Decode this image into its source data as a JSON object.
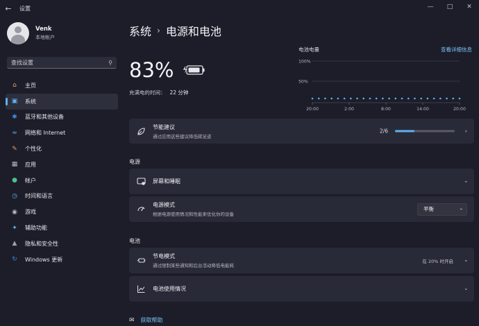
{
  "window": {
    "title": "设置"
  },
  "user": {
    "name": "Venk",
    "account": "本地帐户"
  },
  "search": {
    "placeholder": "查找设置"
  },
  "nav": [
    {
      "label": "主页",
      "icon": "home-icon"
    },
    {
      "label": "系统",
      "icon": "monitor-icon",
      "active": true
    },
    {
      "label": "蓝牙和其他设备",
      "icon": "bluetooth-icon"
    },
    {
      "label": "网络和 Internet",
      "icon": "wifi-icon"
    },
    {
      "label": "个性化",
      "icon": "brush-icon"
    },
    {
      "label": "应用",
      "icon": "apps-icon"
    },
    {
      "label": "帐户",
      "icon": "person-icon"
    },
    {
      "label": "时间和语言",
      "icon": "globe-clock-icon"
    },
    {
      "label": "游戏",
      "icon": "gamepad-icon"
    },
    {
      "label": "辅助功能",
      "icon": "accessibility-icon"
    },
    {
      "label": "隐私和安全性",
      "icon": "shield-icon"
    },
    {
      "label": "Windows 更新",
      "icon": "update-icon"
    }
  ],
  "breadcrumb": {
    "parent": "系统",
    "current": "电源和电池"
  },
  "battery": {
    "percent": "83%",
    "full_label": "充满电的时间：",
    "full_value": "22 分钟"
  },
  "chart": {
    "title": "电池电量",
    "link": "查看详细信息",
    "y_labels": [
      "100%",
      "50%"
    ],
    "x_labels": [
      "20:00",
      "2:00",
      "8:00",
      "14:00",
      "20:00"
    ]
  },
  "chart_data": {
    "type": "bar",
    "title": "电池电量",
    "xlabel": "",
    "ylabel": "",
    "ylim": [
      0,
      100
    ],
    "y_ticks": [
      "100%",
      "50%"
    ],
    "x_ticks": [
      "20:00",
      "2:00",
      "8:00",
      "14:00",
      "20:00"
    ],
    "series": [
      {
        "values": [
          10,
          10,
          10,
          10,
          10,
          10,
          10,
          10,
          10,
          10,
          10,
          10,
          10,
          10,
          10,
          10,
          10,
          10,
          10,
          10,
          10,
          10,
          10,
          10
        ]
      }
    ]
  },
  "energy": {
    "title": "节能建议",
    "subtitle": "通过应用这些建议降低碳足迹",
    "progress_label": "2/6",
    "progress": 0.33
  },
  "sections": {
    "power": "电源",
    "battery": "电池"
  },
  "screen_sleep": {
    "title": "屏幕和睡眠"
  },
  "power_mode": {
    "title": "电源模式",
    "subtitle": "根据电源使用情况和性能来优化你的设备",
    "value": "平衡"
  },
  "saver": {
    "title": "节电模式",
    "subtitle": "通过限制某些通知和后台活动降低电能耗",
    "status": "在 20% 时开启"
  },
  "usage": {
    "title": "电池使用情况"
  },
  "help": {
    "label": "获取帮助"
  },
  "colors": {
    "accent": "#5fb2f2",
    "battery_fill": "#e8e8ee",
    "card": "#292a37",
    "bg": "#1c1d29"
  }
}
